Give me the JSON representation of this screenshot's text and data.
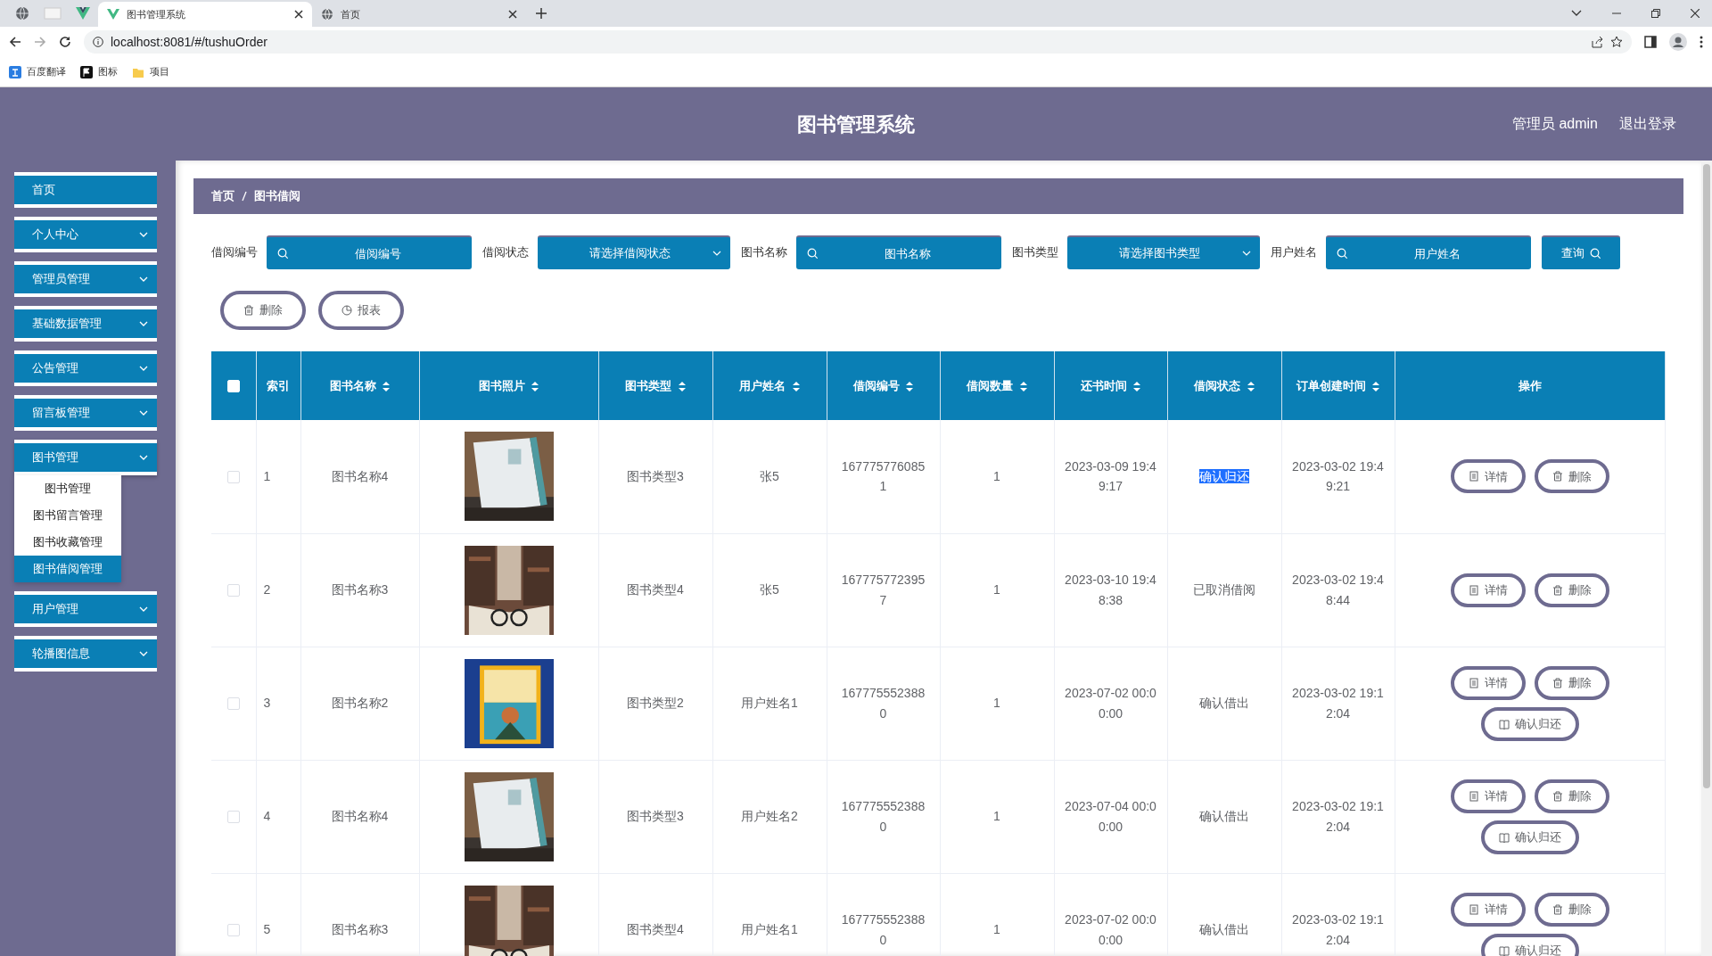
{
  "browser": {
    "tabs": [
      {
        "title": "图书管理系统",
        "selected": true
      },
      {
        "title": "首页",
        "selected": false
      }
    ],
    "url": "localhost:8081/#/tushuOrder",
    "bookmarks": [
      "百度翻译",
      "图标",
      "项目"
    ]
  },
  "header": {
    "title": "图书管理系统",
    "user": "管理员 admin",
    "logout": "退出登录"
  },
  "sidebar": {
    "items": [
      {
        "label": "首页",
        "has_submenu": false
      },
      {
        "label": "个人中心",
        "has_submenu": true,
        "expanded": false
      },
      {
        "label": "管理员管理",
        "has_submenu": true,
        "expanded": false
      },
      {
        "label": "基础数据管理",
        "has_submenu": true,
        "expanded": false
      },
      {
        "label": "公告管理",
        "has_submenu": true,
        "expanded": false
      },
      {
        "label": "留言板管理",
        "has_submenu": true,
        "expanded": false
      },
      {
        "label": "图书管理",
        "has_submenu": true,
        "expanded": true,
        "children": [
          {
            "label": "图书管理",
            "selected": false
          },
          {
            "label": "图书留言管理",
            "selected": false
          },
          {
            "label": "图书收藏管理",
            "selected": false
          },
          {
            "label": "图书借阅管理",
            "selected": true
          }
        ]
      },
      {
        "label": "用户管理",
        "has_submenu": true,
        "expanded": false
      },
      {
        "label": "轮播图信息",
        "has_submenu": true,
        "expanded": false
      }
    ]
  },
  "breadcrumb": [
    "首页",
    "图书借阅"
  ],
  "filters": [
    {
      "kind": "input",
      "label": "借阅编号",
      "placeholder": "借阅编号"
    },
    {
      "kind": "select",
      "label": "借阅状态",
      "placeholder": "请选择借阅状态"
    },
    {
      "kind": "input",
      "label": "图书名称",
      "placeholder": "图书名称"
    },
    {
      "kind": "select",
      "label": "图书类型",
      "placeholder": "请选择图书类型"
    },
    {
      "kind": "input",
      "label": "用户姓名",
      "placeholder": "用户姓名"
    }
  ],
  "search_button": "查询",
  "toolbar": [
    {
      "kind": "delete",
      "label": "删除"
    },
    {
      "kind": "report",
      "label": "报表"
    }
  ],
  "table": {
    "select_all_checked": false,
    "columns": [
      {
        "label": "索引",
        "sortable": false
      },
      {
        "label": "图书名称",
        "sortable": true
      },
      {
        "label": "图书照片",
        "sortable": true
      },
      {
        "label": "图书类型",
        "sortable": true
      },
      {
        "label": "用户姓名",
        "sortable": true
      },
      {
        "label": "借阅编号",
        "sortable": true
      },
      {
        "label": "借阅数量",
        "sortable": true
      },
      {
        "label": "还书时间",
        "sortable": true
      },
      {
        "label": "借阅状态",
        "sortable": true
      },
      {
        "label": "订单创建时间",
        "sortable": true
      },
      {
        "label": "操作",
        "sortable": false
      }
    ],
    "rows": [
      {
        "checked": false,
        "index": "1",
        "name": "图书名称4",
        "photo": {
          "kind": "picture"
        },
        "type": "图书类型3",
        "user": "张5",
        "order_no": "1677757760851",
        "quantity": "1",
        "return_time": "2023-03-09 19:49:17",
        "status": "确认归还",
        "status_text_selected": true,
        "created": "2023-03-02 19:49:21",
        "actions": [
          {
            "kind": "detail",
            "label": "详情"
          },
          {
            "kind": "delete",
            "label": "删除"
          }
        ]
      },
      {
        "checked": false,
        "index": "2",
        "name": "图书名称3",
        "photo": {
          "kind": "picture"
        },
        "type": "图书类型4",
        "user": "张5",
        "order_no": "1677757723957",
        "quantity": "1",
        "return_time": "2023-03-10 19:48:38",
        "status": "已取消借阅",
        "status_text_selected": false,
        "created": "2023-03-02 19:48:44",
        "actions": [
          {
            "kind": "detail",
            "label": "详情"
          },
          {
            "kind": "delete",
            "label": "删除"
          }
        ]
      },
      {
        "checked": false,
        "index": "3",
        "name": "图书名称2",
        "photo": {
          "kind": "picture"
        },
        "type": "图书类型2",
        "user": "用户姓名1",
        "order_no": "1677755523880",
        "quantity": "1",
        "return_time": "2023-07-02 00:00:00",
        "status": "确认借出",
        "status_text_selected": false,
        "created": "2023-03-02 19:12:04",
        "actions": [
          {
            "kind": "detail",
            "label": "详情"
          },
          {
            "kind": "delete",
            "label": "删除"
          },
          {
            "kind": "return",
            "label": "确认归还"
          }
        ]
      },
      {
        "checked": false,
        "index": "4",
        "name": "图书名称4",
        "photo": {
          "kind": "picture"
        },
        "type": "图书类型3",
        "user": "用户姓名2",
        "order_no": "1677755523880",
        "quantity": "1",
        "return_time": "2023-07-04 00:00:00",
        "status": "确认借出",
        "status_text_selected": false,
        "created": "2023-03-02 19:12:04",
        "actions": [
          {
            "kind": "detail",
            "label": "详情"
          },
          {
            "kind": "delete",
            "label": "删除"
          },
          {
            "kind": "return",
            "label": "确认归还"
          }
        ]
      },
      {
        "checked": false,
        "index": "5",
        "name": "图书名称3",
        "photo": {
          "kind": "picture"
        },
        "type": "图书类型4",
        "user": "用户姓名1",
        "order_no": "1677755523880",
        "quantity": "1",
        "return_time": "2023-07-02 00:00:00",
        "status": "确认借出",
        "status_text_selected": false,
        "created": "2023-03-02 19:12:04",
        "actions": [
          {
            "kind": "detail",
            "label": "详情"
          },
          {
            "kind": "delete",
            "label": "删除"
          },
          {
            "kind": "return",
            "label": "确认归还"
          }
        ]
      }
    ]
  }
}
